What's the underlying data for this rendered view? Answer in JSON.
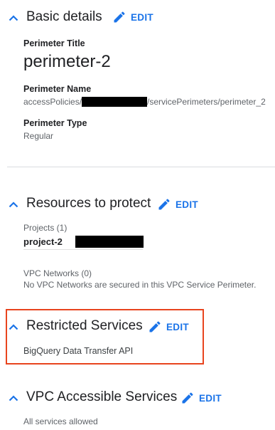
{
  "basic": {
    "title": "Basic details",
    "edit": "EDIT",
    "perimeter_title_label": "Perimeter Title",
    "perimeter_title_value": "perimeter-2",
    "perimeter_name_label": "Perimeter Name",
    "perimeter_name_prefix": "accessPolicies/",
    "perimeter_name_suffix": "/servicePerimeters/perimeter_2",
    "perimeter_type_label": "Perimeter Type",
    "perimeter_type_value": "Regular"
  },
  "resources": {
    "title": "Resources to protect",
    "edit": "EDIT",
    "projects_label": "Projects (1)",
    "project_name": "project-2",
    "vpc_label": "VPC Networks (0)",
    "vpc_empty": "No VPC Networks are secured in this VPC Service Perimeter."
  },
  "restricted": {
    "title": "Restricted Services",
    "edit": "EDIT",
    "service": "BigQuery Data Transfer API",
    "highlight_color": "#e8441e"
  },
  "vpc_accessible": {
    "title": "VPC Accessible Services",
    "edit": "EDIT",
    "value": "All services allowed"
  },
  "icons": {
    "collapse": "chevron-up-icon",
    "edit": "pencil-icon"
  },
  "colors": {
    "accent": "#1a73e8",
    "text": "#202124",
    "secondary": "#5f6368"
  }
}
